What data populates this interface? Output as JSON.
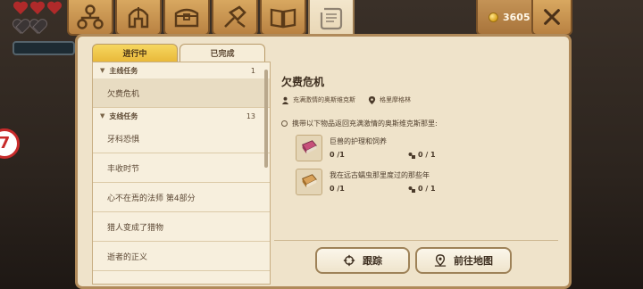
{
  "hud": {
    "hearts_full": 3,
    "hearts_total": 5,
    "side_badge": "7"
  },
  "top_tabs": [
    {
      "icon": "skill-tree-icon"
    },
    {
      "icon": "helmet-icon"
    },
    {
      "icon": "treasure-chest-icon"
    },
    {
      "icon": "crafting-hammer-icon"
    },
    {
      "icon": "open-book-icon"
    },
    {
      "icon": "quest-scroll-icon",
      "active": true
    }
  ],
  "coins": "3605",
  "subtabs": {
    "in_progress": "进行中",
    "completed": "已完成"
  },
  "quest_list": {
    "main_header": "主线任务",
    "main_count": "1",
    "main_items": [
      "欠费危机"
    ],
    "side_header": "支线任务",
    "side_count": "13",
    "side_items": [
      "牙科恐惧",
      "丰收时节",
      "心不在焉的法师 第4部分",
      "猎人变成了猎物",
      "逝者的正义"
    ]
  },
  "detail": {
    "title": "欠费危机",
    "npc_giver": "充满激情的奥斯维克斯",
    "npc_location": "格里摩格林",
    "objective": "携带以下物品返回充满激情的奥斯维克斯那里:",
    "requirements": [
      {
        "name": "巨兽的护理和饲养",
        "have": "0 /1",
        "bank": "0 / 1"
      },
      {
        "name": "我在远古蠕虫那里度过的那些年",
        "have": "0 /1",
        "bank": "0 / 1"
      }
    ],
    "track_button": "跟踪",
    "map_button": "前往地图"
  },
  "colors": {
    "active_subtab": "#e9b93a",
    "panel_bg": "#efe3ca",
    "tab_wood": "#b98242"
  }
}
